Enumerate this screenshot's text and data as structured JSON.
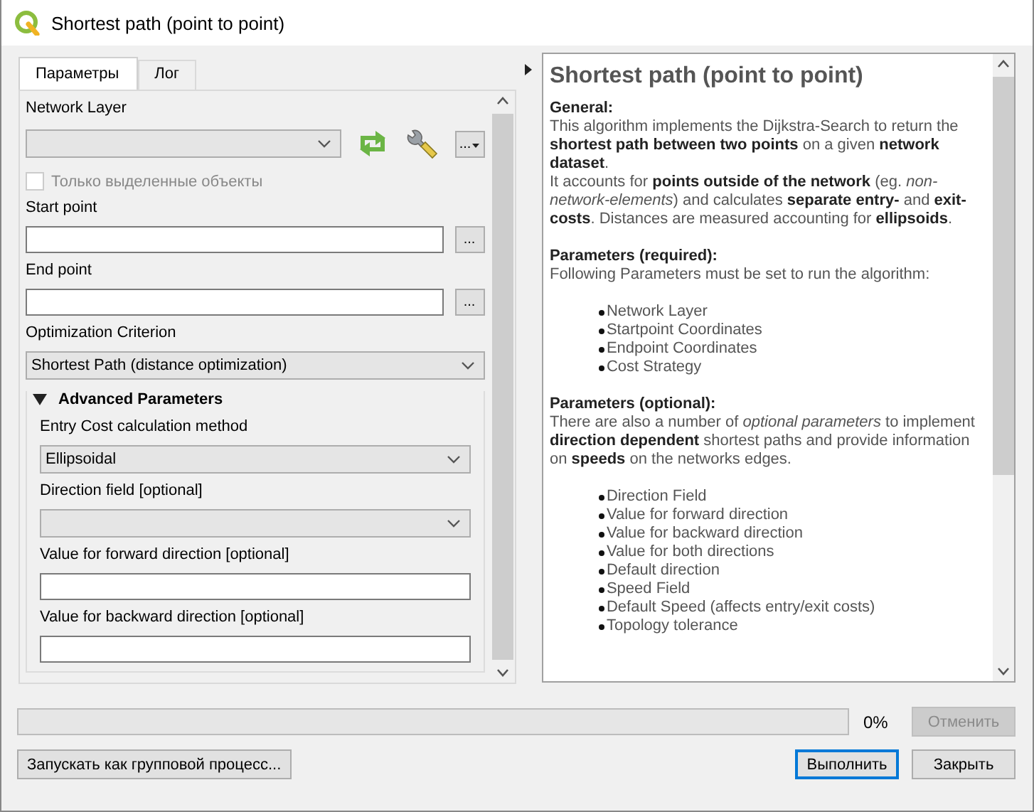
{
  "window": {
    "title": "Shortest path (point to point)"
  },
  "tabs": [
    {
      "label": "Параметры",
      "selected": true
    },
    {
      "label": "Лог",
      "selected": false
    }
  ],
  "parameters": [
    {
      "kind": "layer",
      "label": "Network Layer",
      "browse_label": "...",
      "checkbox": {
        "label": "Только выделенные объекты",
        "checked": false,
        "disabled": true
      }
    },
    {
      "kind": "point",
      "label": "Start point",
      "browse_label": "..."
    },
    {
      "kind": "point",
      "label": "End point",
      "browse_label": "..."
    },
    {
      "kind": "combo",
      "label": "Optimization Criterion",
      "value": "Shortest Path (distance optimization)"
    },
    {
      "kind": "group",
      "title": "Advanced Parameters",
      "expanded": true,
      "children": [
        {
          "kind": "combo",
          "label": "Entry Cost calculation method",
          "value": "Ellipsoidal"
        },
        {
          "kind": "combo",
          "label": "Direction field [optional]"
        },
        {
          "kind": "text",
          "label": "Value for forward direction [optional]"
        },
        {
          "kind": "text",
          "label": "Value for backward direction [optional]"
        }
      ]
    }
  ],
  "help": {
    "title": "Shortest path (point to point)",
    "sections": [
      {
        "heading": "General:",
        "paragraphs": [
          "This algorithm implements the Dijkstra-Search to return the **shortest path between two points** on a given **network dataset**.",
          "It accounts for **points outside of the network** (eg. *non-network-elements*) and calculates **separate entry-** and **exit-costs**. Distances are measured accounting for **ellipsoids**."
        ]
      },
      {
        "heading": "Parameters (required):",
        "paragraphs": [
          "Following Parameters must be set to run the algorithm:"
        ],
        "bullets": [
          "Network Layer",
          "Startpoint Coordinates",
          "Endpoint Coordinates",
          "Cost Strategy"
        ]
      },
      {
        "heading": "Parameters (optional):",
        "paragraphs": [
          "There are also a number of *optional parameters* to implement **direction dependent** shortest paths and provide information on **speeds** on the networks edges."
        ],
        "bullets": [
          "Direction Field",
          "Value for forward direction",
          "Value for backward direction",
          "Value for both directions",
          "Default direction",
          "Speed Field",
          "Default Speed (affects entry/exit costs)",
          "Topology tolerance"
        ]
      }
    ]
  },
  "progress": {
    "level": 0,
    "reading": "0%"
  },
  "buttons": [
    {
      "kind": "cancel",
      "label": "Отменить",
      "disabled": true,
      "default": false
    },
    {
      "kind": "batch",
      "label": "Запускать как групповой процесс...",
      "disabled": false,
      "default": false
    },
    {
      "kind": "action",
      "label": "Выполнить",
      "disabled": false,
      "default": true
    },
    {
      "kind": "action",
      "label": "Закрыть",
      "disabled": false,
      "default": false
    }
  ]
}
